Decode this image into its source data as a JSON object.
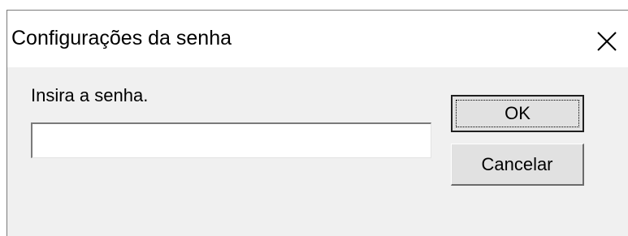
{
  "dialog": {
    "title": "Configurações da senha",
    "prompt": "Insira a senha.",
    "password_value": "",
    "ok_label": "OK",
    "cancel_label": "Cancelar",
    "close_icon": "close-icon"
  }
}
